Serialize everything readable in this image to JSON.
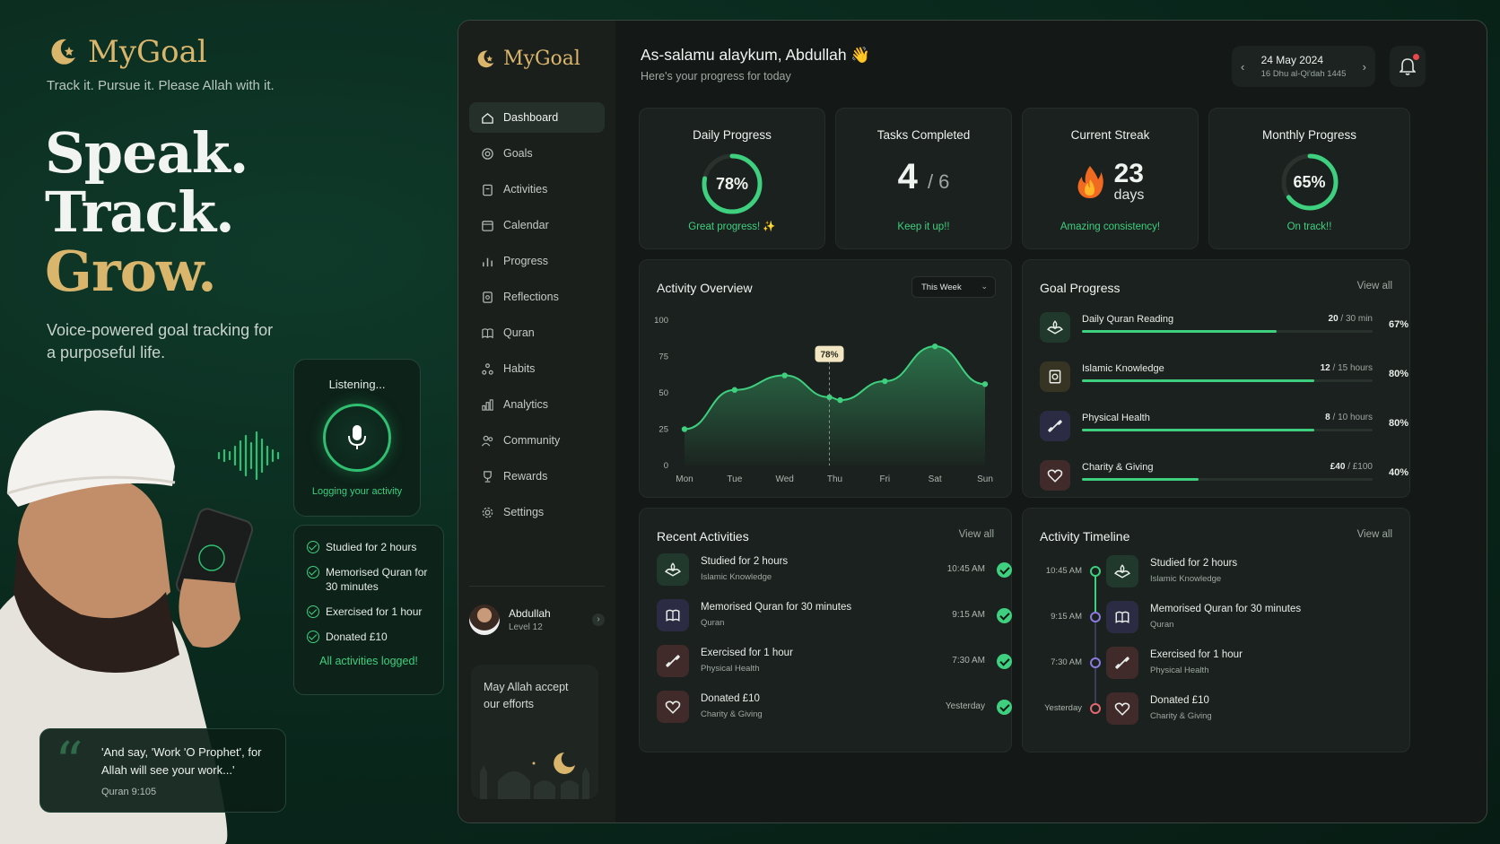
{
  "marketing": {
    "brand": "MyGoal",
    "tagline": "Track it. Pursue it. Please Allah with it.",
    "hero": [
      "Speak.",
      "Track.",
      "Grow."
    ],
    "subtitle": "Voice-powered goal tracking for a purposeful life.",
    "listening": "Listening...",
    "logging": "Logging your activity",
    "logged_items": [
      "Studied for 2 hours",
      "Memorised Quran for 30 minutes",
      "Exercised for 1 hour",
      "Donated £10"
    ],
    "all_logged": "All activities logged!",
    "quote": "'And say, 'Work 'O Prophet', for Allah will see your work...'",
    "quote_ref": "Quran 9:105"
  },
  "sidebar": {
    "brand": "MyGoal",
    "items": [
      {
        "label": "Dashboard",
        "icon": "home-icon",
        "active": true
      },
      {
        "label": "Goals",
        "icon": "target-icon"
      },
      {
        "label": "Activities",
        "icon": "clipboard-icon"
      },
      {
        "label": "Calendar",
        "icon": "calendar-icon"
      },
      {
        "label": "Progress",
        "icon": "bar-chart-icon"
      },
      {
        "label": "Reflections",
        "icon": "journal-icon"
      },
      {
        "label": "Quran",
        "icon": "book-icon"
      },
      {
        "label": "Habits",
        "icon": "habit-icon"
      },
      {
        "label": "Analytics",
        "icon": "analytics-icon"
      },
      {
        "label": "Community",
        "icon": "users-icon"
      },
      {
        "label": "Rewards",
        "icon": "trophy-icon"
      },
      {
        "label": "Settings",
        "icon": "gear-icon"
      }
    ],
    "user": {
      "name": "Abdullah",
      "level": "Level 12"
    },
    "dua": "May Allah accept our efforts"
  },
  "header": {
    "greeting": "As-salamu alaykum, Abdullah 👋",
    "subtitle": "Here's your progress for today",
    "date": "24 May 2024",
    "hijri": "16 Dhu al-Qi'dah 1445"
  },
  "stats": {
    "daily": {
      "title": "Daily Progress",
      "value": "78%",
      "pct": 78,
      "foot": "Great progress! ✨"
    },
    "tasks": {
      "title": "Tasks Completed",
      "done": "4",
      "total": "/ 6",
      "foot": "Keep it up!!"
    },
    "streak": {
      "title": "Current Streak",
      "value": "23",
      "unit": "days",
      "foot": "Amazing consistency!"
    },
    "monthly": {
      "title": "Monthly Progress",
      "value": "65%",
      "pct": 65,
      "foot": "On track!!"
    }
  },
  "activity_overview": {
    "title": "Activity Overview",
    "range": "This Week",
    "highlight_label": "78%"
  },
  "chart_data": {
    "type": "area",
    "categories": [
      "Mon",
      "Tue",
      "Wed",
      "Thu",
      "Fri",
      "Sat",
      "Sun"
    ],
    "y_ticks": [
      0,
      25,
      50,
      75,
      100
    ],
    "ylim": [
      0,
      100
    ],
    "points": [
      {
        "x": "Mon",
        "y": 25
      },
      {
        "x": "Tue",
        "y": 52
      },
      {
        "x": "Wed",
        "y": 62
      },
      {
        "x": "Thu",
        "y": 47
      },
      {
        "x": "Thu",
        "y": 45
      },
      {
        "x": "Fri",
        "y": 58
      },
      {
        "x": "Sat",
        "y": 82
      },
      {
        "x": "Sun",
        "y": 56
      }
    ],
    "highlight": {
      "x": "Thu",
      "y": 78
    }
  },
  "goal_progress": {
    "title": "Goal Progress",
    "view_all": "View all",
    "goals": [
      {
        "name": "Daily Quran Reading",
        "value": "20",
        "unit": "/ 30 min",
        "pct_label": "67%",
        "pct": 67,
        "icon": "quran-icon",
        "color": "#2f7a52"
      },
      {
        "name": "Islamic Knowledge",
        "value": "12",
        "unit": "/ 15 hours",
        "pct_label": "80%",
        "pct": 80,
        "icon": "knowledge-icon",
        "color": "#8a6a2f"
      },
      {
        "name": "Physical Health",
        "value": "8",
        "unit": "/ 10 hours",
        "pct_label": "80%",
        "pct": 80,
        "icon": "dumbbell-icon",
        "color": "#5b4aa8"
      },
      {
        "name": "Charity & Giving",
        "value": "£40",
        "unit": "/ £100",
        "pct_label": "40%",
        "pct": 40,
        "icon": "heart-icon",
        "color": "#a8424a"
      }
    ]
  },
  "recent_activities": {
    "title": "Recent Activities",
    "view_all": "View all",
    "items": [
      {
        "name": "Studied for 2 hours",
        "category": "Islamic Knowledge",
        "time": "10:45 AM",
        "icon": "quran-icon",
        "color": "#2f7a52"
      },
      {
        "name": "Memorised Quran for 30 minutes",
        "category": "Quran",
        "time": "9:15 AM",
        "icon": "book-icon",
        "color": "#5b4aa8"
      },
      {
        "name": "Exercised for 1 hour",
        "category": "Physical Health",
        "time": "7:30 AM",
        "icon": "dumbbell-icon",
        "color": "#a8424a"
      },
      {
        "name": "Donated £10",
        "category": "Charity & Giving",
        "time": "Yesterday",
        "icon": "heart-icon",
        "color": "#a8424a"
      }
    ]
  },
  "timeline": {
    "title": "Activity Timeline",
    "view_all": "View all",
    "items": [
      {
        "time": "10:45 AM",
        "name": "Studied for 2 hours",
        "category": "Islamic Knowledge",
        "icon": "quran-icon",
        "color": "#2f7a52",
        "dot": "#3ed07f"
      },
      {
        "time": "9:15 AM",
        "name": "Memorised Quran for 30 minutes",
        "category": "Quran",
        "icon": "book-icon",
        "color": "#5b4aa8",
        "dot": "#8b7ae0"
      },
      {
        "time": "7:30 AM",
        "name": "Exercised for 1 hour",
        "category": "Physical Health",
        "icon": "dumbbell-icon",
        "color": "#a8424a",
        "dot": "#8b7ae0"
      },
      {
        "time": "Yesterday",
        "name": "Donated £10",
        "category": "Charity & Giving",
        "icon": "heart-icon",
        "color": "#a8424a",
        "dot": "#e5676f"
      }
    ]
  }
}
